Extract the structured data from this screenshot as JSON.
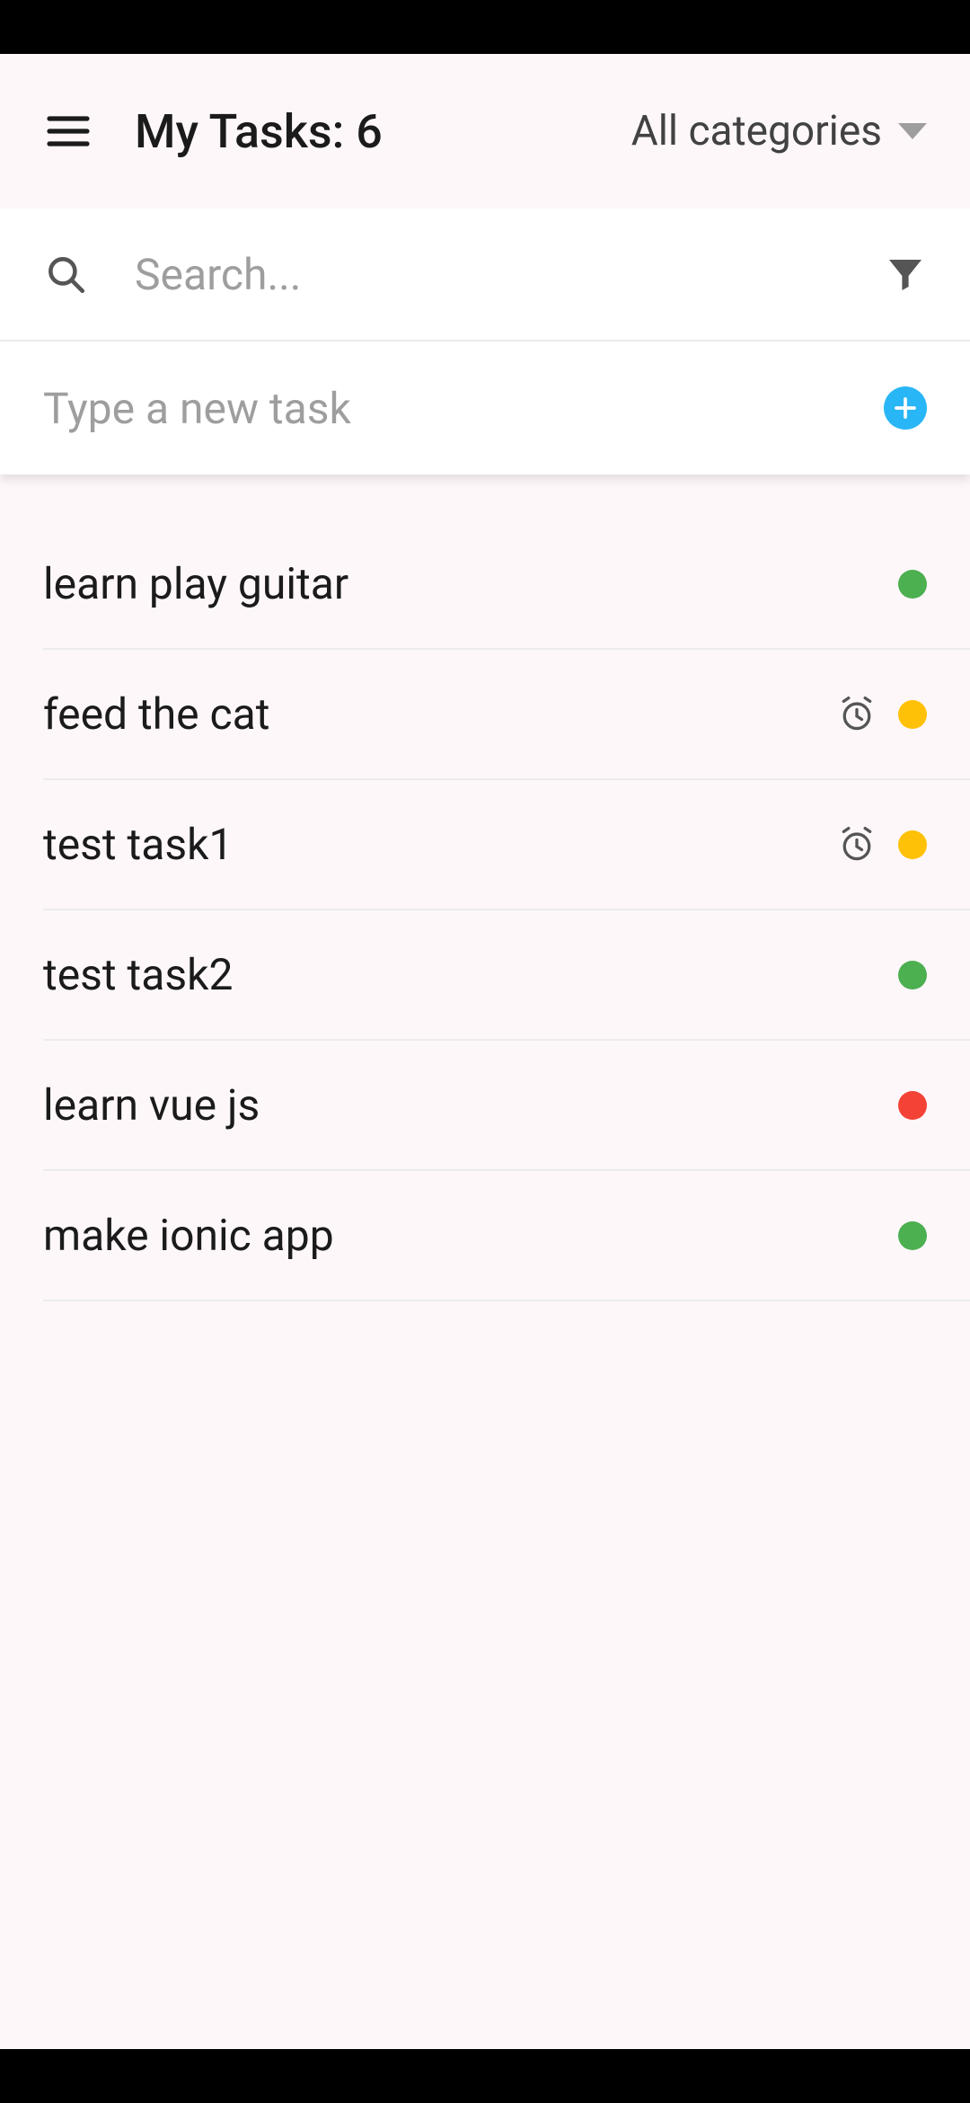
{
  "header": {
    "title": "My Tasks: 6",
    "category_label": "All categories"
  },
  "search": {
    "placeholder": "Search..."
  },
  "new_task": {
    "placeholder": "Type a new task"
  },
  "colors": {
    "green": "#4caf50",
    "yellow": "#ffc107",
    "red": "#f44336",
    "accent": "#29b6f6"
  },
  "tasks": [
    {
      "title": "learn play guitar",
      "has_alarm": false,
      "color": "green"
    },
    {
      "title": "feed the cat",
      "has_alarm": true,
      "color": "yellow"
    },
    {
      "title": "test task1",
      "has_alarm": true,
      "color": "yellow"
    },
    {
      "title": "test task2",
      "has_alarm": false,
      "color": "green"
    },
    {
      "title": "learn vue js",
      "has_alarm": false,
      "color": "red"
    },
    {
      "title": "make ionic app",
      "has_alarm": false,
      "color": "green"
    }
  ]
}
